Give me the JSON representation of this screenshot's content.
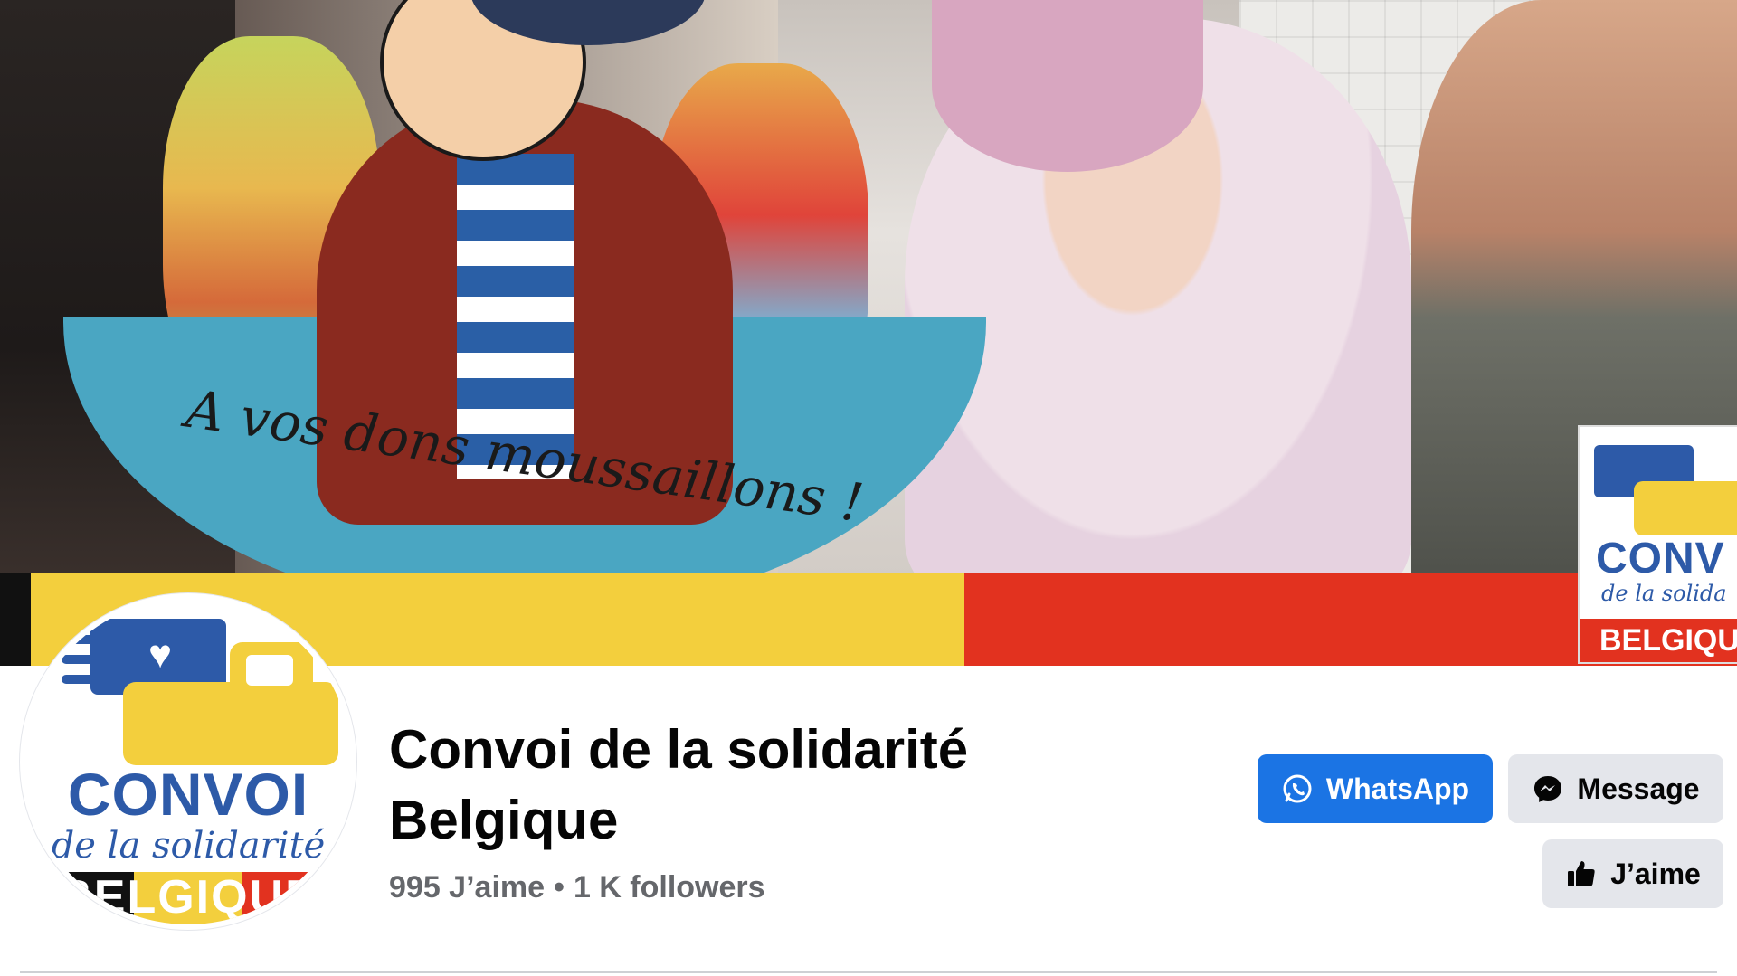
{
  "cover": {
    "banner_text": "A vos dons moussaillons !",
    "corner_logo_name": "CONV",
    "corner_logo_sub": "de la solida",
    "corner_logo_country": "BELGIQU"
  },
  "avatar": {
    "name": "CONVOI",
    "sub": "de la solidarité",
    "country": "BELGIQUE"
  },
  "page": {
    "name_line1": "Convoi de la solidarité",
    "name_line2": "Belgique",
    "likes": "995 J’aime",
    "separator": "•",
    "followers": "1 K followers"
  },
  "actions": {
    "whatsapp_label": "WhatsApp",
    "message_label": "Message",
    "like_label": "J’aime"
  },
  "colors": {
    "primary_button": "#1b74e4",
    "secondary_button": "#e4e6eb",
    "brand_blue": "#2d5aa8",
    "brand_yellow": "#f3cf3d",
    "brand_red": "#e2321f"
  }
}
